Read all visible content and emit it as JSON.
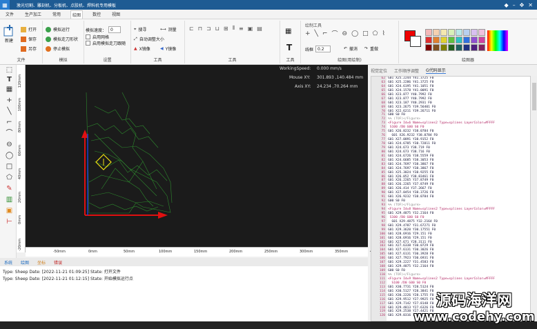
{
  "titlebar": {
    "title": "激光切割、雕刻机、分板机、点胶机、焊料机专用模板"
  },
  "menu": [
    "文件",
    "生产加工",
    "常用",
    "绘图",
    "数控",
    "视图"
  ],
  "menu_active": 3,
  "ribbon": {
    "file": {
      "new": "新建",
      "open": "打开",
      "save": "保存",
      "saveas": "另存",
      "label": "文件"
    },
    "sim": {
      "sim_run": "模拟运行",
      "sim_show": "模拟走刀形状",
      "sim_stop": "停止模拟",
      "label": "模拟"
    },
    "settings": {
      "speed_label": "模拟速度：",
      "speed_value": "0",
      "opt1": "启用网格",
      "opt2": "启用模拟走刀跟随",
      "label": "设置"
    },
    "tools": {
      "search": "搜寻",
      "measure": "测量",
      "autosize": "自动调整大小",
      "xmirror": "X镜像",
      "ymirror": "Y镜像",
      "label": "工具"
    },
    "tools2_label": "工具",
    "text_label": "工具",
    "draw": {
      "header": "绘制工具",
      "linewidth_label": "线框",
      "linewidth_value": "0.2",
      "undo": "撤消",
      "redo": "重做",
      "label": "绘图(用绘制)"
    },
    "colors_label": "绘图器"
  },
  "canvas": {
    "ws_label": "WorkingSpeed:",
    "ws_value": "0.000 mm/s",
    "mouse_label": "Mouse XY:",
    "mouse_value": "301.893 ,140.484 mm",
    "axis_label": "Axis XY:",
    "axis_value": "24.234 ,70.264 mm",
    "hruler": [
      "-50mm",
      "0mm",
      "50mm",
      "100mm",
      "150mm",
      "200mm",
      "250mm",
      "300mm",
      "350mm",
      "400mm"
    ],
    "vruler": [
      "120mm",
      "100mm",
      "80mm",
      "60mm",
      "40mm",
      "20mm",
      "0mm",
      "-20mm"
    ]
  },
  "status_tabs": [
    "系统",
    "绘图",
    "坐标",
    "错误"
  ],
  "log": [
    "Type: Sheep  Date: [2022-11-21 01:09:25]  State: 打开文件",
    "Type: Sheep  Date: [2022-11-21 01:12:15]  State: 开始模拟运行点"
  ],
  "right_tabs": [
    "视觉定位",
    "工作顺序调整",
    "G代码显示"
  ],
  "right_tab_active": 2,
  "code_lines": [
    [
      "G01 X25.2244 Y41.3725 F0",
      "g"
    ],
    [
      "G01 X25.2286 Y41.3725 F0",
      "g"
    ],
    [
      "G01 X24.6195 Y41.1051 F0",
      "g"
    ],
    [
      "G01 X24.1578 Y41.0091 F0",
      "g"
    ],
    [
      "G01 X23.877 Y40.7992 F0",
      "g"
    ],
    [
      "G01 X23.877 Y40.7992 F0",
      "g"
    ],
    [
      "G01 X23.187 Y40.2931 F0",
      "g"
    ],
    [
      "G01 X23.2675 Y39.56401 F0",
      "g"
    ],
    [
      "G01 X22.6211 Y39.26711 F0",
      "g"
    ],
    [
      "G00 S0 F0",
      "g"
    ],
    [
      "%% (TOF)</Figure>",
      "c"
    ],
    [
      "<Figure Id=6 Name=splines2 Type=splines LayerColor=#FFFF",
      "t"
    ],
    [
      " S100 /D0 G00 S0 F0",
      "t"
    ],
    [
      "G01 X26.8232 Y38.0784 F0",
      "g"
    ],
    [
      "  G01 X26.9232 Y38.0784 F0",
      "g"
    ],
    [
      "G01 X27.0891 Y38.9152 F0",
      "g"
    ],
    [
      "G01 X24.6785 Y38.72811 F0",
      "g"
    ],
    [
      "G01 X24.673 Y38.719 F0",
      "g"
    ],
    [
      "G01 X24.673 Y38.716 F0",
      "g"
    ],
    [
      "G01 X24.6726 Y38.5559 F0",
      "g"
    ],
    [
      "G01 X24.6685 Y38.3053 F0",
      "g"
    ],
    [
      "G01 X24.7697 Y38.3867 F0",
      "g"
    ],
    [
      "G01 X24.7697 Y38.3867 F0",
      "g"
    ],
    [
      "G01 X25.3024 Y38.9255 F0",
      "g"
    ],
    [
      "G01 X26.052 Y38.83461 F0",
      "g"
    ],
    [
      "G01 X26.2265 Y37.8749 F0",
      "g"
    ],
    [
      "G01 X26.2265 Y37.8749 F0",
      "g"
    ],
    [
      "G01 X26.414 Y37.2667 F0",
      "g"
    ],
    [
      "G01 X27.0454 Y38.3726 F0",
      "g"
    ],
    [
      "G01 X26.9232 Y38.0784 F0",
      "g"
    ],
    [
      "G00 S0 F0",
      "g"
    ],
    [
      "%% (TOF)</Figure>",
      "c"
    ],
    [
      "<Figure Id=8 Name=splines2 Type=splines LayerColor=#FFFF",
      "t"
    ],
    [
      "G01 X29.4875 Y32.2164 F0",
      "g"
    ],
    [
      " S100 /D0 G00 S0 F0",
      "t"
    ],
    [
      "  G01 X29.4875 Y32.2164 F0",
      "g"
    ],
    [
      "G01 X29.4787 Y31.67271 F0",
      "g"
    ],
    [
      "G01 X29.3620 Y30.17551 F0",
      "g"
    ],
    [
      "G01 X28.6916 Y29.151 F0",
      "g"
    ],
    [
      "G01 X28.6916 Y29.151 F0",
      "g"
    ],
    [
      "G01 X27.671 Y28.3111 F0",
      "g"
    ],
    [
      "G01 X27.6338 Y30.0729 F0",
      "g"
    ],
    [
      "G01 X27.6131 Y30.3026 F0",
      "g"
    ],
    [
      "G01 X27.6131 Y30.3928 F0",
      "g"
    ],
    [
      "G01 X27.7923 Y30.6931 F0",
      "g"
    ],
    [
      "G01 X29.2227 Y31.4583 F0",
      "g"
    ],
    [
      "G01 X29.4875 Y32.2164 F0",
      "g"
    ],
    [
      "G00 S0 F0",
      "g"
    ],
    [
      "%% (TOF)</Figure>",
      "c"
    ],
    [
      "<Figure Id=9 Name=splines2 Type=splines LayerColor=#FFFF",
      "t"
    ],
    [
      "  S100 /D0 G00 S0 F0",
      "t"
    ],
    [
      "G01 X30.7731 Y28.5124 F0",
      "g"
    ],
    [
      "G01 X30.5127 Y28.3841 F0",
      "g"
    ],
    [
      "G01 X30.2226 Y28.1755 F0",
      "g"
    ],
    [
      "G01 X29.9512 Y27.9925 F0",
      "g"
    ],
    [
      "G01 X29.7142 Y27.8148 F0",
      "g"
    ],
    [
      "G01 X29.4813 Y27.6326 F0",
      "g"
    ],
    [
      "G01 X29.2538 Y27.4421 F0",
      "g"
    ],
    [
      "G01 X29.0316 Y27.2515 F0",
      "g"
    ]
  ],
  "code_start_line": 62,
  "watermark": {
    "line1": "源码海洋网",
    "line2": "www.codehy.com"
  }
}
